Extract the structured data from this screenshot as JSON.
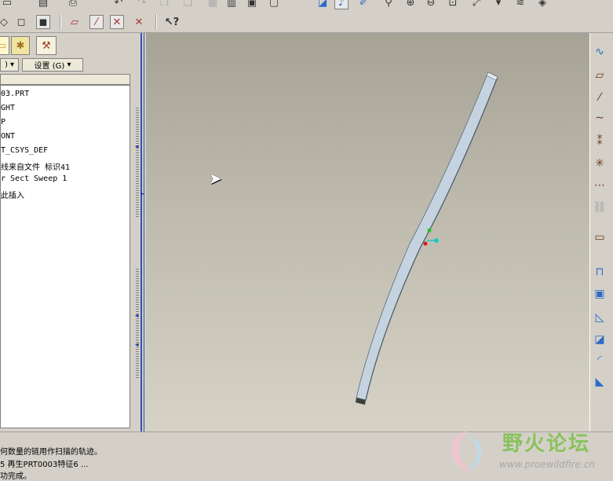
{
  "toolbar": {
    "top_icons": [
      "folder-icon",
      "undo-icon",
      "redo-icon",
      "copy-icon",
      "paste-icon",
      "regen-icon",
      "view-icon",
      "zoom-in-icon",
      "zoom-out-icon",
      "refit-icon",
      "orient-icon",
      "spin-icon"
    ],
    "datum_icons": [
      "plane-icon",
      "axis-icon",
      "point-icon",
      "csys-icon"
    ],
    "whats_this_icon": "help-cursor-icon"
  },
  "navigator": {
    "menu_label": "设置 (G)",
    "show_label": ")",
    "tree_items": [
      "03.PRT",
      "GHT",
      "P",
      "ONT",
      "T_CSYS_DEF",
      "线来自文件 标识41",
      "r Sect Sweep 1",
      "此插入"
    ]
  },
  "messages": [
    "何数量的链用作扫描的轨迹。",
    "5 再生PRT0003特征6 ...",
    "功完成。"
  ],
  "watermark": {
    "title": "野火论坛",
    "url": "www.proewildfire.cn"
  },
  "colors": {
    "viewport_top": "#a6a396",
    "viewport_bottom": "#d6d3c6",
    "sweep_body": "#c5d3e0",
    "watermark_green": "#7cc04a"
  }
}
